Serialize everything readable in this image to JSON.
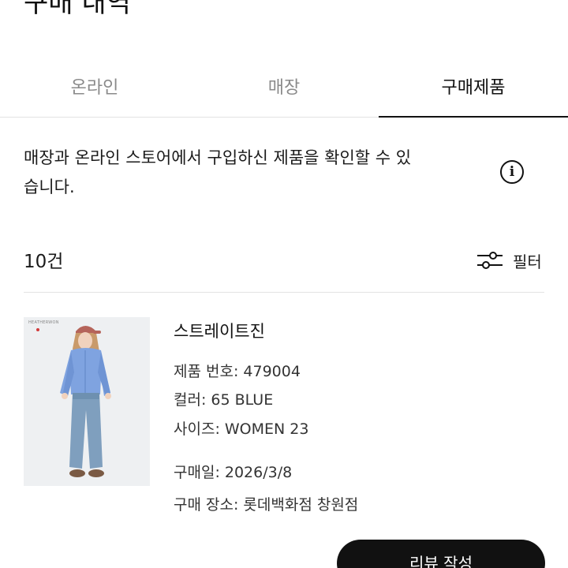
{
  "header": {
    "title": "구매 내역"
  },
  "tabs": [
    {
      "label": "온라인",
      "active": false
    },
    {
      "label": "매장",
      "active": false
    },
    {
      "label": "구매제품",
      "active": true
    }
  ],
  "notice": {
    "line1": "매장과 온라인 스토어에서 구입하신 제품을 확인할 수 있",
    "line2": "습니다.",
    "icon": "info-icon"
  },
  "list_header": {
    "count": "10건",
    "filter_label": "필터",
    "filter_icon": "sliders-icon"
  },
  "product": {
    "name": "스트레이트진",
    "product_number": "제품 번호: 479004",
    "color": "컬러: 65 BLUE",
    "size": "사이즈: WOMEN 23",
    "purchase_date": "구매일: 2026/3/8",
    "purchase_place": "구매 장소: 롯데백화점 창원점",
    "image_brand_text": "HEATHERWON"
  },
  "actions": {
    "review_label": "리뷰 작성"
  },
  "colors": {
    "accent": "#111111",
    "tab_inactive": "#8a8a8a",
    "divider": "#e3e3e3"
  }
}
